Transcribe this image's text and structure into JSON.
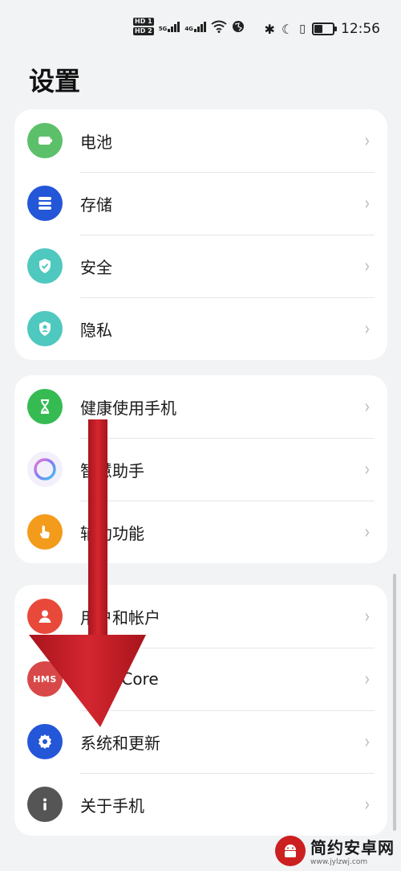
{
  "status_bar": {
    "hd1": "HD 1",
    "hd2": "HD 2",
    "net1": "5G",
    "net2": "4G",
    "time": "12:56"
  },
  "page_title": "设置",
  "groups": [
    {
      "items": [
        {
          "label": "电池",
          "icon": "battery-icon",
          "color": "#5cc06a"
        },
        {
          "label": "存储",
          "icon": "storage-icon",
          "color": "#2456d8"
        },
        {
          "label": "安全",
          "icon": "shield-icon",
          "color": "#4fc8bf"
        },
        {
          "label": "隐私",
          "icon": "privacy-icon",
          "color": "#4fc8bf"
        }
      ]
    },
    {
      "items": [
        {
          "label": "健康使用手机",
          "icon": "hourglass-icon",
          "color": "#36bb52"
        },
        {
          "label": "智慧助手",
          "icon": "assistant-icon",
          "color": "#ffffff"
        },
        {
          "label": "辅助功能",
          "icon": "hand-icon",
          "color": "#f39b1b"
        }
      ]
    },
    {
      "items": [
        {
          "label": "用户和帐户",
          "icon": "user-icon",
          "color": "#e8493a"
        },
        {
          "label": "HMS Core",
          "icon": "hms-icon",
          "icon_text": "HMS",
          "color": "#d94848"
        },
        {
          "label": "系统和更新",
          "icon": "gear-icon",
          "color": "#2456d8"
        },
        {
          "label": "关于手机",
          "icon": "info-icon",
          "color": "#555555"
        }
      ]
    }
  ],
  "watermark": {
    "title": "简约安卓网",
    "url": "www.jylzwj.com"
  },
  "colors": {
    "background": "#f1f3f5",
    "card": "#ffffff",
    "arrow": "#c8202a"
  }
}
